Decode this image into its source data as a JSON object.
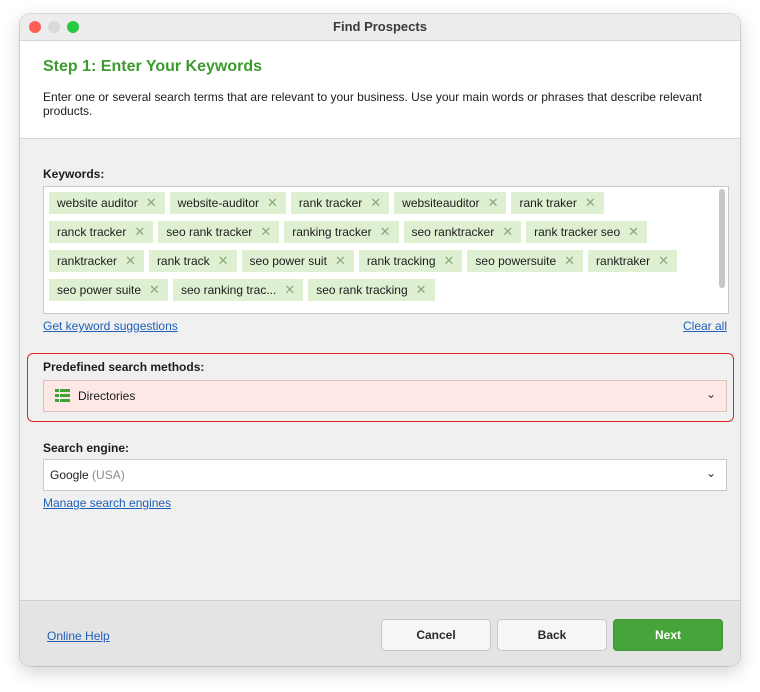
{
  "window": {
    "title": "Find Prospects"
  },
  "header": {
    "step_title": "Step 1: Enter Your Keywords",
    "description": "Enter one or several search terms that are relevant to your business. Use your main words or phrases that describe relevant products."
  },
  "keywords": {
    "label": "Keywords:",
    "items": [
      "website auditor",
      "website-auditor",
      "rank tracker",
      "websiteauditor",
      "rank traker",
      "ranck tracker",
      "seo rank tracker",
      "ranking tracker",
      "seo ranktracker",
      "rank tracker seo",
      "ranktracker",
      "rank track",
      "seo power suit",
      "rank tracking",
      "seo powersuite",
      "ranktraker",
      "seo power suite",
      "seo ranking trac...",
      "seo rank tracking"
    ],
    "remove_glyph": "✕",
    "suggest_link": "Get keyword suggestions",
    "clear_link": "Clear all"
  },
  "predefined": {
    "label": "Predefined search methods:",
    "selected": "Directories",
    "icon": "list-grid-icon",
    "highlight_color": "#e0242b"
  },
  "engine": {
    "label": "Search engine:",
    "selected": "Google",
    "region": "(USA)",
    "manage_link": "Manage search engines"
  },
  "footer": {
    "help_link": "Online Help",
    "cancel": "Cancel",
    "back": "Back",
    "next": "Next",
    "accent": "#47a43a"
  },
  "caret_glyph": "⌄"
}
